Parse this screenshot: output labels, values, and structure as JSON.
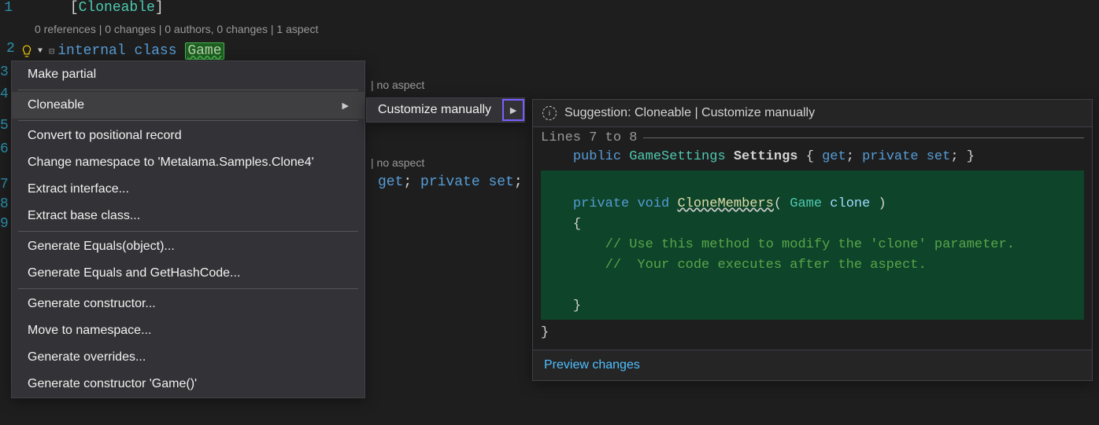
{
  "editor": {
    "lines": {
      "l1_num": "1",
      "l1_attr": "Cloneable",
      "codelens1": "0 references | 0 changes | 0 authors, 0 changes | 1 aspect",
      "l2_num": "2",
      "l2_keyword_internal": "internal",
      "l2_keyword_class": "class",
      "l2_classname": "Game",
      "hidden_nums": [
        "3",
        "4",
        "5",
        "6",
        "7",
        "8",
        "9"
      ]
    },
    "background": {
      "no_aspect1": "| no aspect",
      "no_aspect2": "| no aspect",
      "get_set": "get; private set;"
    }
  },
  "context_menu": {
    "items": [
      {
        "label": "Make partial",
        "submenu": false
      },
      {
        "label": "Cloneable",
        "submenu": true,
        "selected": true
      },
      {
        "label": "Convert to positional record",
        "submenu": false
      },
      {
        "label": "Change namespace to 'Metalama.Samples.Clone4'",
        "submenu": false
      },
      {
        "label": "Extract interface...",
        "submenu": false
      },
      {
        "label": "Extract base class...",
        "submenu": false
      },
      {
        "label": "Generate Equals(object)...",
        "submenu": false
      },
      {
        "label": "Generate Equals and GetHashCode...",
        "submenu": false
      },
      {
        "label": "Generate constructor...",
        "submenu": false
      },
      {
        "label": "Move to namespace...",
        "submenu": false
      },
      {
        "label": "Generate overrides...",
        "submenu": false
      },
      {
        "label": "Generate constructor 'Game()'",
        "submenu": false
      }
    ]
  },
  "submenu": {
    "label": "Customize manually"
  },
  "suggestion": {
    "title": "Suggestion: Cloneable | Customize manually",
    "lines_label": "Lines 7 to 8",
    "code": {
      "line1": {
        "kw_public": "public",
        "type": "GameSettings",
        "name": "Settings",
        "brace_open": "{",
        "kw_get": "get",
        "semi1": ";",
        "kw_private": "private",
        "kw_set": "set",
        "semi2": ";",
        "brace_close": "}"
      },
      "inserted": {
        "kw_private": "private",
        "kw_void": "void",
        "method": "CloneMembers",
        "paren_open": "(",
        "type": "Game",
        "param": "clone",
        "paren_close": ")",
        "brace_open": "{",
        "comment1": "// Use this method to modify the 'clone' parameter.",
        "comment2": "//  Your code executes after the aspect.",
        "brace_close": "}"
      },
      "closing_brace": "}"
    },
    "footer_link": "Preview changes"
  }
}
